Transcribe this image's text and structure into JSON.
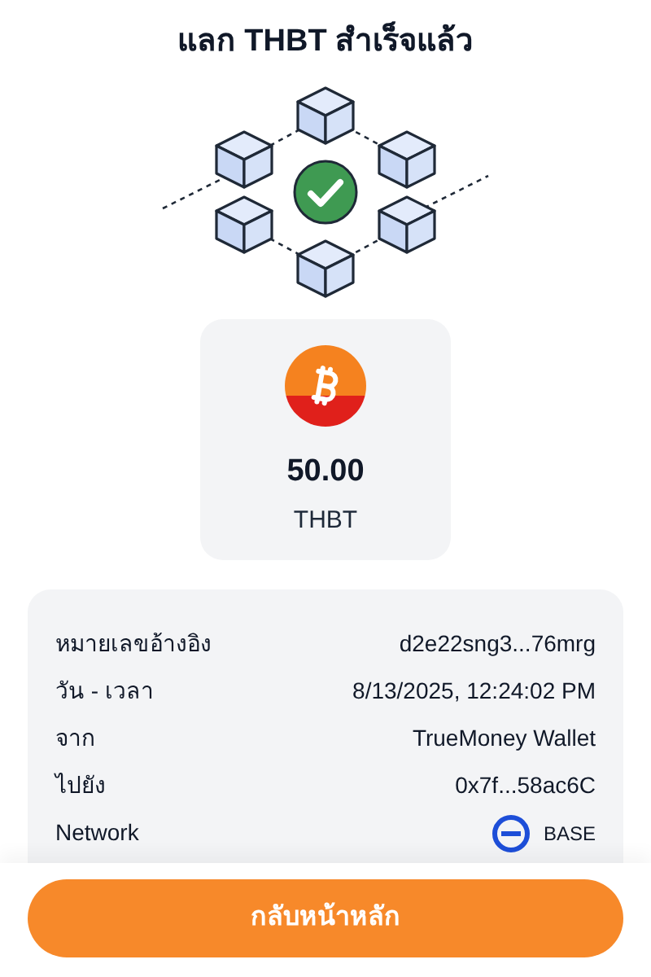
{
  "title": "แลก THBT สำเร็จแล้ว",
  "amount": {
    "value": "50.00",
    "currency": "THBT"
  },
  "details": [
    {
      "kind": "text",
      "label": "หมายเลขอ้างอิง",
      "value": "d2e22sng3...76mrg"
    },
    {
      "kind": "text",
      "label": "วัน - เวลา",
      "value": "8/13/2025, 12:24:02 PM"
    },
    {
      "kind": "text",
      "label": "จาก",
      "value": "TrueMoney Wallet"
    },
    {
      "kind": "text",
      "label": "ไปยัง",
      "value": "0x7f...58ac6C"
    },
    {
      "kind": "network",
      "label": "Network",
      "value": "BASE"
    }
  ],
  "button": {
    "label": "กลับหน้าหลัก"
  }
}
